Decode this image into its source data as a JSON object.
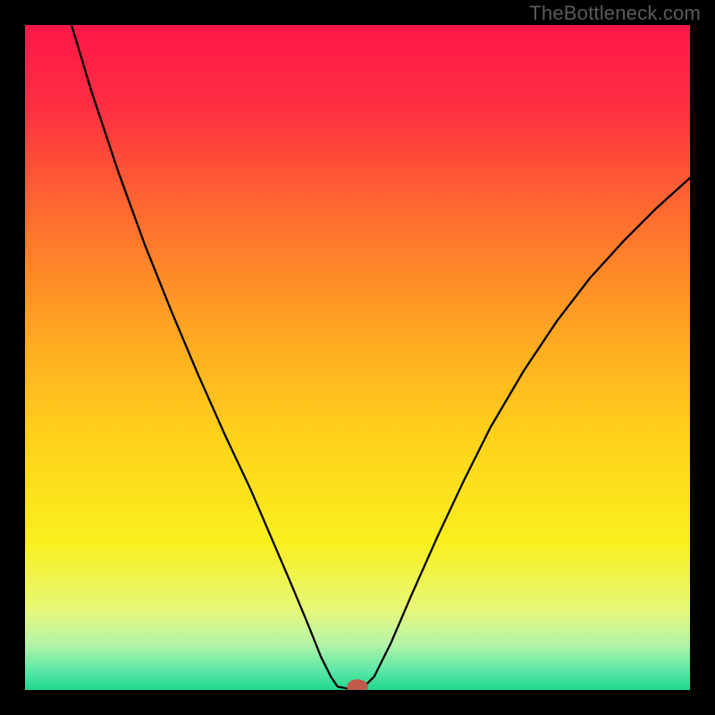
{
  "watermark": "TheBottleneck.com",
  "chart_data": {
    "type": "line",
    "title": "",
    "xlabel": "",
    "ylabel": "",
    "xlim": [
      0,
      100
    ],
    "ylim": [
      0,
      100
    ],
    "background": {
      "gradient_stops": [
        {
          "offset": 0.0,
          "color": "#ff1747"
        },
        {
          "offset": 0.12,
          "color": "#ff2e42"
        },
        {
          "offset": 0.28,
          "color": "#ff6a2f"
        },
        {
          "offset": 0.45,
          "color": "#ffa323"
        },
        {
          "offset": 0.62,
          "color": "#ffd21a"
        },
        {
          "offset": 0.78,
          "color": "#f9f01e"
        },
        {
          "offset": 0.88,
          "color": "#e7f87a"
        },
        {
          "offset": 0.93,
          "color": "#b6f4a7"
        },
        {
          "offset": 0.97,
          "color": "#5de8a6"
        },
        {
          "offset": 1.0,
          "color": "#1fd88e"
        }
      ]
    },
    "series": [
      {
        "name": "bottleneck-curve",
        "color": "#000000",
        "width": 2.3,
        "points": [
          {
            "x": 7.0,
            "y": 100.0
          },
          {
            "x": 10.0,
            "y": 90.0
          },
          {
            "x": 14.0,
            "y": 78.0
          },
          {
            "x": 18.0,
            "y": 67.0
          },
          {
            "x": 22.0,
            "y": 57.0
          },
          {
            "x": 26.0,
            "y": 47.5
          },
          {
            "x": 30.0,
            "y": 38.5
          },
          {
            "x": 34.0,
            "y": 30.0
          },
          {
            "x": 37.0,
            "y": 23.0
          },
          {
            "x": 40.0,
            "y": 16.0
          },
          {
            "x": 42.5,
            "y": 10.0
          },
          {
            "x": 44.5,
            "y": 5.0
          },
          {
            "x": 46.0,
            "y": 2.0
          },
          {
            "x": 47.0,
            "y": 0.5
          },
          {
            "x": 48.5,
            "y": 0.2
          },
          {
            "x": 50.0,
            "y": 0.2
          },
          {
            "x": 51.0,
            "y": 0.5
          },
          {
            "x": 52.5,
            "y": 2.0
          },
          {
            "x": 55.0,
            "y": 7.0
          },
          {
            "x": 58.0,
            "y": 14.0
          },
          {
            "x": 62.0,
            "y": 23.0
          },
          {
            "x": 66.0,
            "y": 31.5
          },
          {
            "x": 70.0,
            "y": 39.5
          },
          {
            "x": 75.0,
            "y": 48.0
          },
          {
            "x": 80.0,
            "y": 55.5
          },
          {
            "x": 85.0,
            "y": 62.0
          },
          {
            "x": 90.0,
            "y": 67.5
          },
          {
            "x": 95.0,
            "y": 72.5
          },
          {
            "x": 100.0,
            "y": 77.0
          }
        ]
      }
    ],
    "marker": {
      "x": 50.0,
      "y": 0.5,
      "rx": 1.6,
      "ry": 1.1,
      "color": "#c05a4a"
    }
  }
}
